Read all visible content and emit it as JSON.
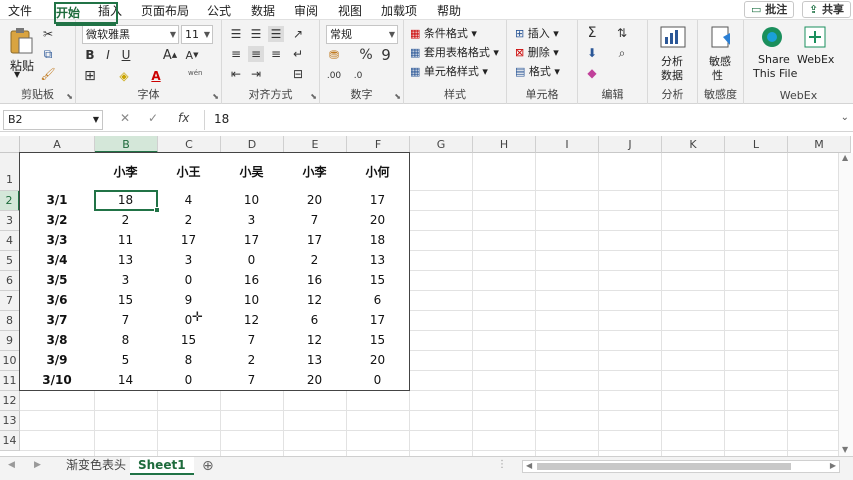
{
  "menu": {
    "tabs": [
      "文件",
      "开始",
      "插入",
      "页面布局",
      "公式",
      "数据",
      "审阅",
      "视图",
      "加载项",
      "帮助"
    ],
    "active": "开始",
    "comment": "批注",
    "share": "共享"
  },
  "ribbon": {
    "clipboard": {
      "label": "剪贴板",
      "paste": "粘贴"
    },
    "font": {
      "label": "字体",
      "name": "微软雅黑",
      "size": "11",
      "pinyin": "wén"
    },
    "alignment": {
      "label": "对齐方式"
    },
    "number": {
      "label": "数字",
      "format": "常规"
    },
    "styles": {
      "label": "样式",
      "conditional": "条件格式",
      "table": "套用表格格式",
      "cell": "单元格样式"
    },
    "cells": {
      "label": "单元格",
      "insert": "插入",
      "delete": "删除",
      "format": "格式"
    },
    "editing": {
      "label": "编辑"
    },
    "analysis": {
      "label": "分析",
      "button1": "分析",
      "button2": "数据"
    },
    "sensitivity": {
      "label": "敏感度",
      "button1": "敏感",
      "button2": "性"
    },
    "webex": {
      "label": "WebEx",
      "share1": "Share",
      "share2": "This File",
      "webex": "WebEx"
    }
  },
  "formula_bar": {
    "name_box": "B2",
    "fx": "fx",
    "value": "18"
  },
  "columns": [
    "A",
    "B",
    "C",
    "D",
    "E",
    "F",
    "G",
    "H",
    "I",
    "J",
    "K",
    "L",
    "M"
  ],
  "rows": [
    "1",
    "2",
    "3",
    "4",
    "5",
    "6",
    "7",
    "8",
    "9",
    "10",
    "11",
    "12",
    "13",
    "14"
  ],
  "selected_cell": "B2",
  "table": {
    "headers": [
      "",
      "小李",
      "小王",
      "小吴",
      "小李",
      "小何"
    ],
    "rows": [
      [
        "3/1",
        "18",
        "4",
        "10",
        "20",
        "17"
      ],
      [
        "3/2",
        "2",
        "2",
        "3",
        "7",
        "20"
      ],
      [
        "3/3",
        "11",
        "17",
        "17",
        "17",
        "18"
      ],
      [
        "3/4",
        "13",
        "3",
        "0",
        "2",
        "13"
      ],
      [
        "3/5",
        "3",
        "0",
        "16",
        "16",
        "15"
      ],
      [
        "3/6",
        "15",
        "9",
        "10",
        "12",
        "6"
      ],
      [
        "3/7",
        "7",
        "0",
        "12",
        "6",
        "17"
      ],
      [
        "3/8",
        "8",
        "15",
        "7",
        "12",
        "15"
      ],
      [
        "3/9",
        "5",
        "8",
        "2",
        "13",
        "20"
      ],
      [
        "3/10",
        "14",
        "0",
        "7",
        "20",
        "0"
      ]
    ]
  },
  "sheet_tabs": [
    {
      "label": "渐变色表头",
      "active": false
    },
    {
      "label": "Sheet1",
      "active": true
    }
  ],
  "colors": {
    "accent": "#217346",
    "selection": "#d4e7d9"
  }
}
